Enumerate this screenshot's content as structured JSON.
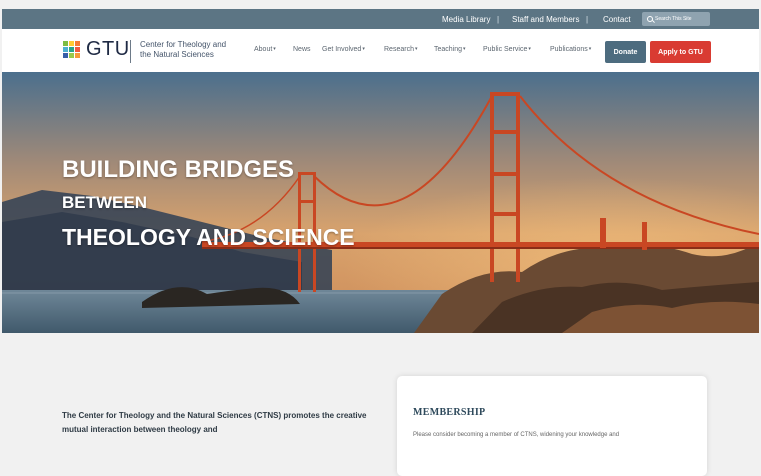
{
  "utility_bar": {
    "links": [
      "Media Library",
      "Staff and Members",
      "Contact"
    ],
    "separator": "|",
    "search_placeholder": "Search This Site"
  },
  "header": {
    "logo_text": "GTU",
    "subtitle_line1": "Center for Theology and",
    "subtitle_line2": "the Natural Sciences"
  },
  "nav": {
    "about": "About",
    "news": "News",
    "get_involved": "Get Involved",
    "research": "Research",
    "teaching": "Teaching",
    "public_service": "Public Service",
    "publications": "Publications",
    "caret": "▾"
  },
  "buttons": {
    "donate": "Donate",
    "apply": "Apply to GTU"
  },
  "hero": {
    "line1": "BUILDING BRIDGES",
    "line2": "BETWEEN",
    "line3": "THEOLOGY AND SCIENCE"
  },
  "intro": {
    "text": "The Center for Theology and the Natural Sciences (CTNS) promotes the creative mutual interaction between theology and"
  },
  "membership": {
    "title": "MEMBERSHIP",
    "text": "Please consider becoming a member of CTNS, widening your knowledge and"
  },
  "colors": {
    "utility_bar": "#5c7584",
    "donate": "#4d6c7f",
    "apply": "#d93b32",
    "bridge": "#c94723"
  }
}
